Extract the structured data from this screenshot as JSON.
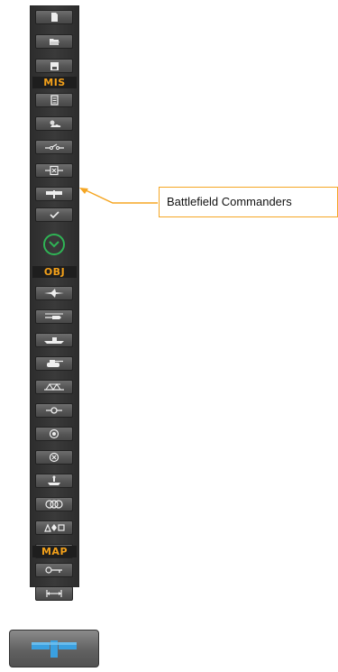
{
  "toolbar": {
    "section_mission": "MIS",
    "section_objects": "OBJ",
    "section_map": "MAP",
    "top_buttons": [
      "new-file-icon",
      "open-folder-icon",
      "save-disk-icon"
    ],
    "mission_buttons": [
      "briefing-clipboard-icon",
      "weather-icon",
      "trigger-switch-icon",
      "resource-manager-icon",
      "battlefield-commanders-icon",
      "check-icon"
    ],
    "object_buttons": [
      "airplane-icon",
      "helicopter-icon",
      "ship-icon",
      "ground-unit-icon",
      "static-bridge-icon",
      "waypoint-icon",
      "target-icon",
      "cancel-circle-icon",
      "farp-icon",
      "zones-icon",
      "shapes-icon",
      "delete-icon"
    ],
    "map_buttons": [
      "key-icon",
      "ruler-icon"
    ],
    "colors": {
      "accent": "#f2a01a",
      "ok": "#2fb455",
      "delete": "#e03030",
      "highlight": "#3aa0e0"
    }
  },
  "callout": {
    "label": "Battlefield Commanders"
  },
  "zoom": {
    "icon": "battlefield-commanders-icon"
  }
}
